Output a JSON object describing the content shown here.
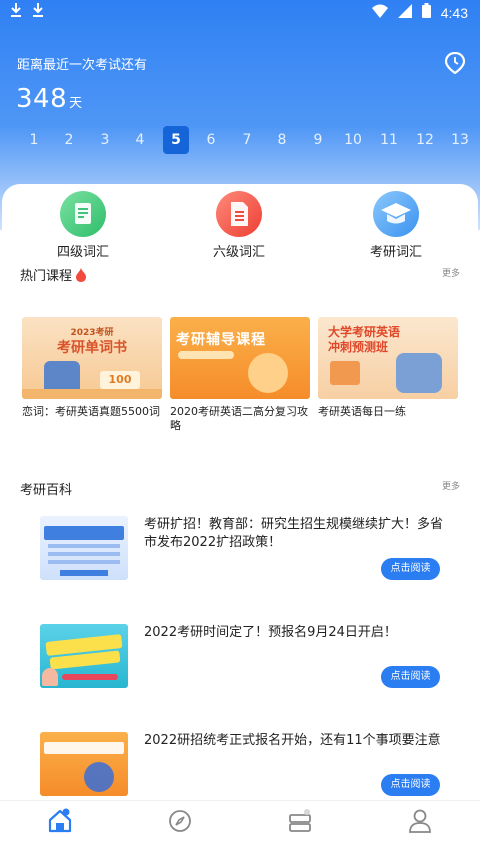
{
  "status_bar": {
    "time": "4:43"
  },
  "countdown": {
    "label": "距离最近一次考试还有",
    "days": "348",
    "unit": "天"
  },
  "weeks": [
    "1",
    "2",
    "3",
    "4",
    "5",
    "6",
    "7",
    "8",
    "9",
    "10",
    "11",
    "12",
    "13"
  ],
  "active_week": "5",
  "categories": [
    {
      "label": "四级词汇",
      "color": "#48c97a"
    },
    {
      "label": "六级词汇",
      "color": "#f15c4e"
    },
    {
      "label": "考研词汇",
      "color": "#4aa3f4"
    }
  ],
  "hot_courses": {
    "title": "热门课程",
    "more": "更多",
    "items": [
      {
        "title": "恋词：考研英语真题5500词",
        "banner_line1": "2023考研",
        "banner_line2": "考研单词书",
        "banner_number": "100"
      },
      {
        "title": "2020考研英语二高分复习攻略",
        "banner_line1": "考研辅导课程",
        "banner_line2": ""
      },
      {
        "title": "考研英语每日一练",
        "banner_line1": "大学考研英语",
        "banner_line2": "冲刺预测班"
      }
    ]
  },
  "encyclopedia": {
    "title": "考研百科",
    "more": "更多",
    "items": [
      {
        "title": "考研扩招！教育部：研究生招生规模继续扩大！多省市发布2022扩招政策！",
        "button": "点击阅读"
      },
      {
        "title": "2022考研时间定了！预报名9月24日开启！",
        "button": "点击阅读"
      },
      {
        "title": "2022研招统考正式报名开始，还有11个事项要注意",
        "button": "点击阅读"
      }
    ]
  },
  "tabbar": [
    "home-icon",
    "compass-icon",
    "book-icon",
    "profile-icon"
  ]
}
